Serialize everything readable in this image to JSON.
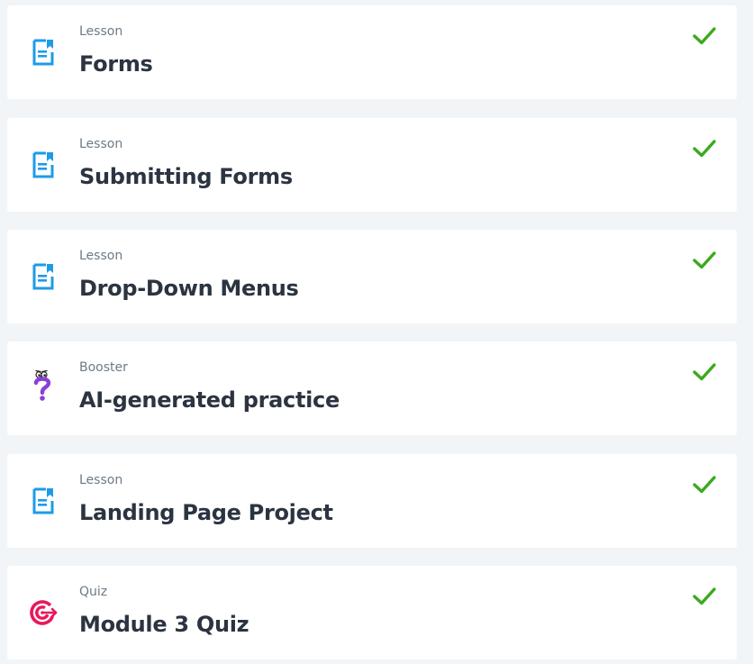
{
  "items": [
    {
      "type": "Lesson",
      "title": "Forms",
      "icon": "lesson-document-icon",
      "status": "completed"
    },
    {
      "type": "Lesson",
      "title": "Submitting Forms",
      "icon": "lesson-document-icon",
      "status": "completed"
    },
    {
      "type": "Lesson",
      "title": "Drop-Down Menus",
      "icon": "lesson-document-icon",
      "status": "completed"
    },
    {
      "type": "Booster",
      "title": "AI-generated practice",
      "icon": "booster-question-icon",
      "status": "completed"
    },
    {
      "type": "Lesson",
      "title": "Landing Page Project",
      "icon": "lesson-document-icon",
      "status": "completed"
    },
    {
      "type": "Quiz",
      "title": "Module 3 Quiz",
      "icon": "quiz-target-icon",
      "status": "completed"
    }
  ],
  "colors": {
    "background": "#f2f5f7",
    "card": "#ffffff",
    "lesson_icon": "#1e9be9",
    "booster_icon": "#8b3fd9",
    "quiz_icon": "#e8185a",
    "check": "#3aaa1f",
    "type_text": "#6d7a86",
    "title_text": "#2b3440"
  }
}
